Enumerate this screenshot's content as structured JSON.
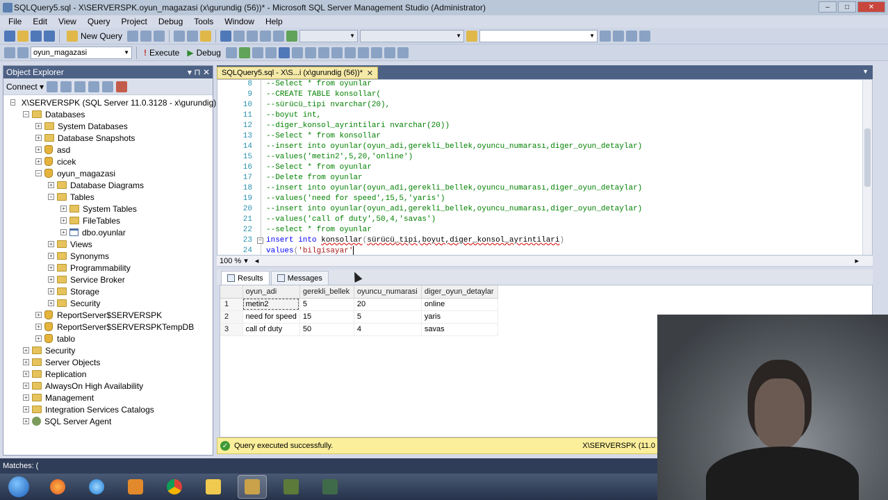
{
  "window": {
    "title": "SQLQuery5.sql - X\\SERVERSPK.oyun_magazasi (x\\gurundig (56))* - Microsoft SQL Server Management Studio (Administrator)"
  },
  "menu": [
    "File",
    "Edit",
    "View",
    "Query",
    "Project",
    "Debug",
    "Tools",
    "Window",
    "Help"
  ],
  "toolbar1": {
    "new_query": "New Query"
  },
  "toolbar2": {
    "database": "oyun_magazasi",
    "execute": "Execute",
    "debug": "Debug"
  },
  "object_explorer": {
    "title": "Object Explorer",
    "connect": "Connect",
    "tree": [
      {
        "label": "X\\SERVERSPK (SQL Server 11.0.3128 - x\\gurundig)",
        "level": 0,
        "exp": "−",
        "icon": "server"
      },
      {
        "label": "Databases",
        "level": 1,
        "exp": "−",
        "icon": "folder"
      },
      {
        "label": "System Databases",
        "level": 2,
        "exp": "+",
        "icon": "folder"
      },
      {
        "label": "Database Snapshots",
        "level": 2,
        "exp": "+",
        "icon": "folder"
      },
      {
        "label": "asd",
        "level": 2,
        "exp": "+",
        "icon": "db"
      },
      {
        "label": "cicek",
        "level": 2,
        "exp": "+",
        "icon": "db"
      },
      {
        "label": "oyun_magazasi",
        "level": 2,
        "exp": "−",
        "icon": "db"
      },
      {
        "label": "Database Diagrams",
        "level": 3,
        "exp": "+",
        "icon": "folder"
      },
      {
        "label": "Tables",
        "level": 3,
        "exp": "−",
        "icon": "folder"
      },
      {
        "label": "System Tables",
        "level": 4,
        "exp": "+",
        "icon": "folder"
      },
      {
        "label": "FileTables",
        "level": 4,
        "exp": "+",
        "icon": "folder"
      },
      {
        "label": "dbo.oyunlar",
        "level": 4,
        "exp": "+",
        "icon": "table"
      },
      {
        "label": "Views",
        "level": 3,
        "exp": "+",
        "icon": "folder"
      },
      {
        "label": "Synonyms",
        "level": 3,
        "exp": "+",
        "icon": "folder"
      },
      {
        "label": "Programmability",
        "level": 3,
        "exp": "+",
        "icon": "folder"
      },
      {
        "label": "Service Broker",
        "level": 3,
        "exp": "+",
        "icon": "folder"
      },
      {
        "label": "Storage",
        "level": 3,
        "exp": "+",
        "icon": "folder"
      },
      {
        "label": "Security",
        "level": 3,
        "exp": "+",
        "icon": "folder"
      },
      {
        "label": "ReportServer$SERVERSPK",
        "level": 2,
        "exp": "+",
        "icon": "db"
      },
      {
        "label": "ReportServer$SERVERSPKTempDB",
        "level": 2,
        "exp": "+",
        "icon": "db"
      },
      {
        "label": "tablo",
        "level": 2,
        "exp": "+",
        "icon": "db"
      },
      {
        "label": "Security",
        "level": 1,
        "exp": "+",
        "icon": "folder"
      },
      {
        "label": "Server Objects",
        "level": 1,
        "exp": "+",
        "icon": "folder"
      },
      {
        "label": "Replication",
        "level": 1,
        "exp": "+",
        "icon": "folder"
      },
      {
        "label": "AlwaysOn High Availability",
        "level": 1,
        "exp": "+",
        "icon": "folder"
      },
      {
        "label": "Management",
        "level": 1,
        "exp": "+",
        "icon": "folder"
      },
      {
        "label": "Integration Services Catalogs",
        "level": 1,
        "exp": "+",
        "icon": "folder"
      },
      {
        "label": "SQL Server Agent",
        "level": 1,
        "exp": "+",
        "icon": "agent"
      }
    ]
  },
  "editor": {
    "tab_label": "SQLQuery5.sql - X\\S...i (x\\gurundig (56))*",
    "zoom": "100 %",
    "lines": [
      {
        "n": "8",
        "text": "--Select * from oyunlar",
        "type": "comment"
      },
      {
        "n": "9",
        "text": "--CREATE TABLE konsollar(",
        "type": "comment"
      },
      {
        "n": "10",
        "text": "--sürücü_tipi nvarchar(20),",
        "type": "comment"
      },
      {
        "n": "11",
        "text": "--boyut int,",
        "type": "comment"
      },
      {
        "n": "12",
        "text": "--diger_konsol_ayrintilari nvarchar(20))",
        "type": "comment"
      },
      {
        "n": "13",
        "text": "--Select * from konsollar",
        "type": "comment"
      },
      {
        "n": "14",
        "text": "--insert into oyunlar(oyun_adi,gerekli_bellek,oyuncu_numarası,diger_oyun_detaylar)",
        "type": "comment"
      },
      {
        "n": "15",
        "text": "--values('metin2',5,20,'online')",
        "type": "comment"
      },
      {
        "n": "16",
        "text": "--Select * from oyunlar",
        "type": "comment"
      },
      {
        "n": "17",
        "text": "--Delete from oyunlar",
        "type": "comment"
      },
      {
        "n": "18",
        "text": "--insert into oyunlar(oyun_adi,gerekli_bellek,oyuncu_numarası,diger_oyun_detaylar)",
        "type": "comment"
      },
      {
        "n": "19",
        "text": "--values('need for speed',15,5,'yaris')",
        "type": "comment"
      },
      {
        "n": "20",
        "text": "--insert into oyunlar(oyun_adi,gerekli_bellek,oyuncu_numarası,diger_oyun_detaylar)",
        "type": "comment"
      },
      {
        "n": "21",
        "text": "--values('call of duty',50,4,'savas')",
        "type": "comment"
      },
      {
        "n": "22",
        "text": "--select * from oyunlar",
        "type": "comment"
      },
      {
        "n": "23",
        "text": "",
        "type": "insert"
      },
      {
        "n": "24",
        "text": "",
        "type": "values"
      }
    ],
    "line23": {
      "kw": "insert into",
      "table": "konsollar",
      "cols": "sürücü_tipi,boyut,diger_konsol_ayrintilari"
    },
    "line24": {
      "kw": "values",
      "str": "'bilgisayar'"
    }
  },
  "results": {
    "tab_results": "Results",
    "tab_messages": "Messages",
    "columns": [
      "oyun_adi",
      "gerekli_bellek",
      "oyuncu_numarasi",
      "diger_oyun_detaylar"
    ],
    "rows": [
      [
        "1",
        "metin2",
        "5",
        "20",
        "online"
      ],
      [
        "2",
        "need for speed",
        "15",
        "5",
        "yaris"
      ],
      [
        "3",
        "call of duty",
        "50",
        "4",
        "savas"
      ]
    ]
  },
  "status": {
    "message": "Query executed successfully.",
    "server": "X\\SERVERSPK (11.0"
  },
  "matches": "Matches: ("
}
